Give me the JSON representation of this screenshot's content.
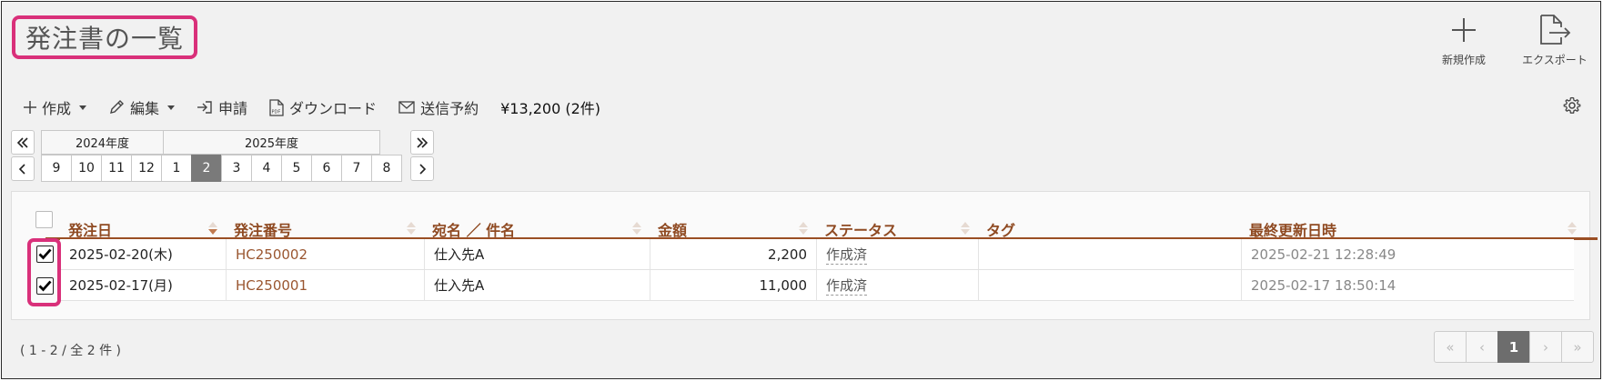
{
  "page": {
    "title": "発注書の一覧"
  },
  "top_actions": [
    {
      "label": "新規作成",
      "icon": "plus-icon"
    },
    {
      "label": "エクスポート",
      "icon": "export-icon"
    }
  ],
  "toolbar": {
    "create": "作成",
    "edit": "編集",
    "apply": "申請",
    "download": "ダウンロード",
    "schedule_send": "送信予約",
    "total": "¥13,200 (2件)"
  },
  "period": {
    "years": [
      "2024年度",
      "2025年度"
    ],
    "months": [
      "9",
      "10",
      "11",
      "12",
      "1",
      "2",
      "3",
      "4",
      "5",
      "6",
      "7",
      "8"
    ],
    "selected_month": "2"
  },
  "table": {
    "columns": [
      "発注日",
      "発注番号",
      "宛名 ／ 件名",
      "金額",
      "ステータス",
      "タグ",
      "最終更新日時"
    ],
    "rows": [
      {
        "checked": true,
        "date": "2025-02-20(木)",
        "number": "HC250002",
        "name": "仕入先A",
        "amount": "2,200",
        "status": "作成済",
        "tag": "",
        "updated": "2025-02-21 12:28:49"
      },
      {
        "checked": true,
        "date": "2025-02-17(月)",
        "number": "HC250001",
        "name": "仕入先A",
        "amount": "11,000",
        "status": "作成済",
        "tag": "",
        "updated": "2025-02-17 18:50:14"
      }
    ]
  },
  "footer": {
    "count": "( 1 - 2 / 全 2 件 )",
    "pages": [
      "«",
      "‹",
      "1",
      "›",
      "»"
    ],
    "current_page": "1"
  },
  "colors": {
    "accent_brown": "#9a4e24",
    "highlight_pink": "#d9307a",
    "link": "#9a5630"
  }
}
